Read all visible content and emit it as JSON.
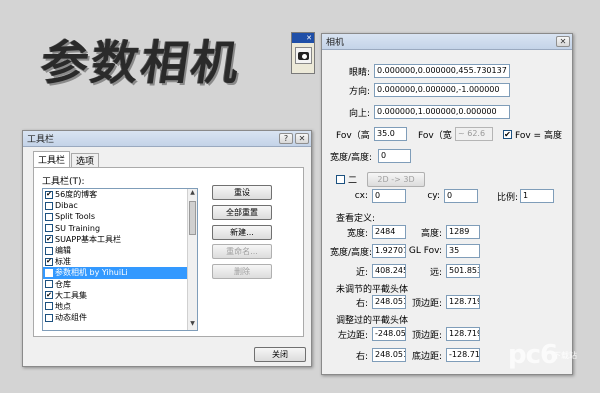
{
  "hero_title": "参数相机",
  "mini_toolbar": {
    "grip_glyph": "✕"
  },
  "camera_window": {
    "title": "相机",
    "close_glyph": "✕",
    "eye_label": "眼睛:",
    "eye_value": "0.000000,0.000000,455.730137",
    "dir_label": "方向:",
    "dir_value": "0.000000,0.000000,-1.000000",
    "up_label": "向上:",
    "up_value": "0.000000,1.000000,0.000000",
    "fov_h_label": "Fov（高",
    "fov_h_value": "35.0",
    "fov_w_label": "Fov（宽",
    "fov_w_value": "~ 62.6",
    "fov_eq_label": "Fov = 高度",
    "aspect_label": "宽度/高度:",
    "aspect_value": "0",
    "twod_label": "二",
    "twod_button": "2D -> 3D",
    "cx_label": "cx:",
    "cx_value": "0",
    "cy_label": "cy:",
    "cy_value": "0",
    "ratio_label": "比例:",
    "ratio_value": "1",
    "view_def_label": "查看定义:",
    "width_label": "宽度:",
    "width_value": "2484",
    "height_label": "高度:",
    "height_value": "1289",
    "aspect2_label": "宽度/高度:",
    "aspect2_value": "1.927075",
    "glfov_label": "GL Fov:",
    "glfov_value": "35",
    "near_label": "近:",
    "near_value": "408.2455",
    "far_label": "远:",
    "far_value": "501.8531",
    "unadj_label": "未调节的平截头体",
    "unadj_right_label": "右:",
    "unadj_right_value": "248.0518",
    "unadj_top_label": "顶边距:",
    "unadj_top_value": "128.7193",
    "adj_label": "调整过的平截头体",
    "adj_left_label": "左边距:",
    "adj_left_value": "-248.0518",
    "adj_top_label": "顶边距:",
    "adj_top_value": "128.7193",
    "adj_right_label": "右:",
    "adj_right_value": "248.0518",
    "adj_bottom_label": "底边距:",
    "adj_bottom_value": "-128.7193"
  },
  "toolbar_window": {
    "title": "工具栏",
    "help_glyph": "?",
    "close_glyph": "✕",
    "tabs": [
      "工具栏",
      "选项"
    ],
    "list_label": "工具栏(T):",
    "items": [
      {
        "label": "56度的博客",
        "checked": true,
        "selected": false
      },
      {
        "label": "Dibac",
        "checked": false,
        "selected": false
      },
      {
        "label": "Split Tools",
        "checked": false,
        "selected": false
      },
      {
        "label": "SU Training",
        "checked": false,
        "selected": false
      },
      {
        "label": "SUAPP基本工具栏",
        "checked": true,
        "selected": false
      },
      {
        "label": "编辑",
        "checked": false,
        "selected": false
      },
      {
        "label": "标准",
        "checked": true,
        "selected": false
      },
      {
        "label": "参数相机 by YihuiLi",
        "checked": true,
        "selected": true
      },
      {
        "label": "仓库",
        "checked": false,
        "selected": false
      },
      {
        "label": "大工具集",
        "checked": true,
        "selected": false
      },
      {
        "label": "地点",
        "checked": false,
        "selected": false
      },
      {
        "label": "动态组件",
        "checked": false,
        "selected": false
      }
    ],
    "buttons": {
      "reset": "重设",
      "reset_all": "全部重置",
      "new": "新建...",
      "rename": "重命名...",
      "delete": "删除"
    },
    "close_button": "关闭"
  },
  "watermark": {
    "main": "pc6",
    "sub": "下载站"
  }
}
